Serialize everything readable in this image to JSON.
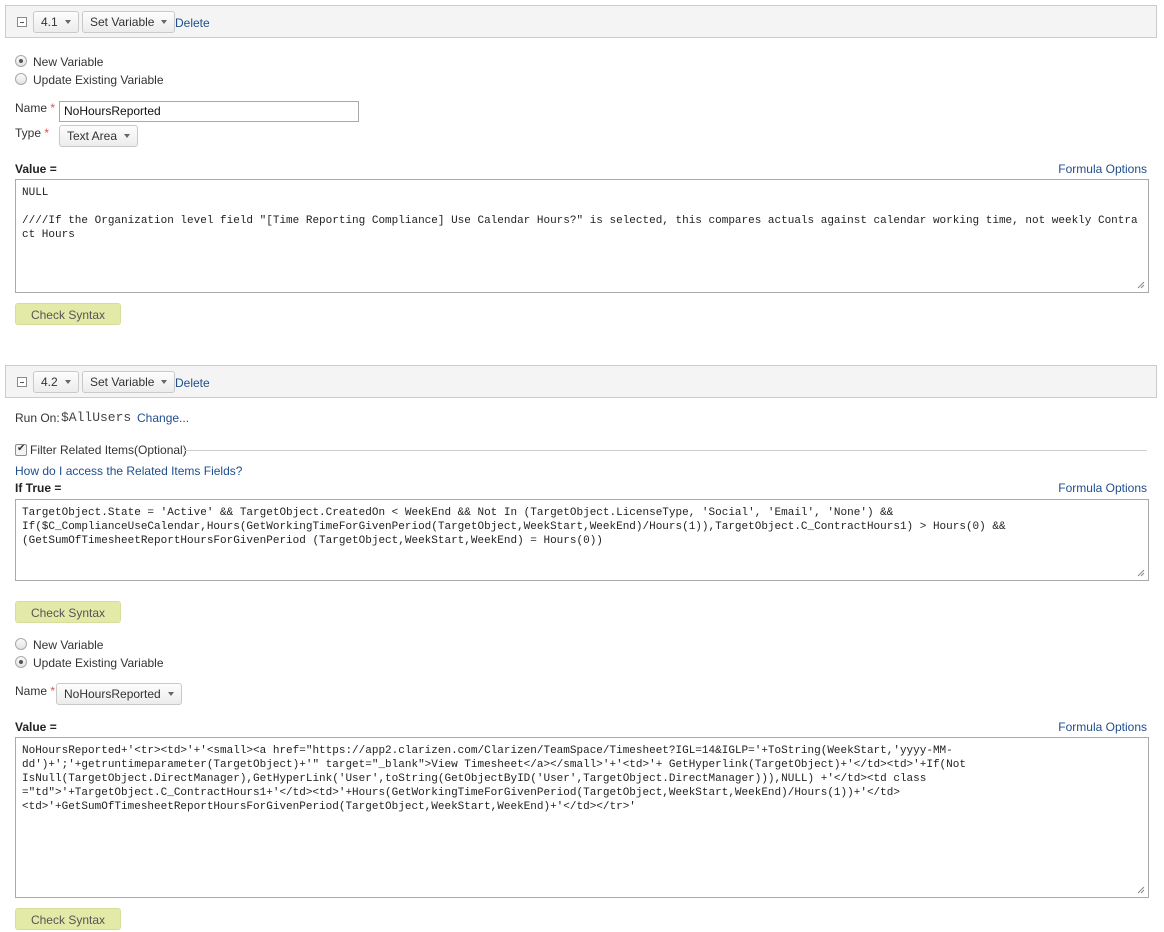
{
  "step1": {
    "number": "4.1",
    "action": "Set Variable",
    "delete_label": "Delete",
    "radio_new": "New Variable",
    "radio_update": "Update Existing Variable",
    "selected_radio": "new",
    "name_label": "Name",
    "required_mark": "*",
    "name_value": "NoHoursReported",
    "type_label": "Type",
    "type_value": "Text Area",
    "value_label": "Value =",
    "formula_options": "Formula Options",
    "value_text": "NULL\n\n////If the Organization level field \"[Time Reporting Compliance] Use Calendar Hours?\" is selected, this compares actuals against calendar working time, not weekly Contract Hours",
    "check_syntax": "Check Syntax"
  },
  "step2": {
    "number": "4.2",
    "action": "Set Variable",
    "delete_label": "Delete",
    "run_on_label": "Run On:",
    "run_on_value": "$AllUsers",
    "change_link": "Change...",
    "filter_label": "Filter Related Items(Optional)",
    "filter_checked": true,
    "help_link": "How do I access the Related Items Fields?",
    "if_true_label": "If True =",
    "formula_options": "Formula Options",
    "if_true_text": "TargetObject.State = 'Active' && TargetObject.CreatedOn < WeekEnd && Not In (TargetObject.LicenseType, 'Social', 'Email', 'None') &&\nIf($C_ComplianceUseCalendar,Hours(GetWorkingTimeForGivenPeriod(TargetObject,WeekStart,WeekEnd)/Hours(1)),TargetObject.C_ContractHours1) > Hours(0) &&\n(GetSumOfTimesheetReportHoursForGivenPeriod (TargetObject,WeekStart,WeekEnd) = Hours(0))",
    "check_syntax_1": "Check Syntax",
    "radio_new": "New Variable",
    "radio_update": "Update Existing Variable",
    "selected_radio": "update",
    "name_label": "Name",
    "required_mark": "*",
    "name_value": "NoHoursReported",
    "value_label": "Value =",
    "formula_options_2": "Formula Options",
    "value_text": "NoHoursReported+'<tr><td>'+'<small><a href=\"https://app2.clarizen.com/Clarizen/TeamSpace/Timesheet?IGL=14&IGLP='+ToString(WeekStart,'yyyy-MM-\ndd')+';'+getruntimeparameter(TargetObject)+'\" target=\"_blank\">View Timesheet</a></small>'+'<td>'+ GetHyperlink(TargetObject)+'</td><td>'+If(Not\nIsNull(TargetObject.DirectManager),GetHyperLink('User',toString(GetObjectByID('User',TargetObject.DirectManager))),NULL) +'</td><td class\n=\"td\">'+TargetObject.C_ContractHours1+'</td><td>'+Hours(GetWorkingTimeForGivenPeriod(TargetObject,WeekStart,WeekEnd)/Hours(1))+'</td>\n<td>'+GetSumOfTimesheetReportHoursForGivenPeriod(TargetObject,WeekStart,WeekEnd)+'</td></tr>'",
    "check_syntax_2": "Check Syntax"
  }
}
